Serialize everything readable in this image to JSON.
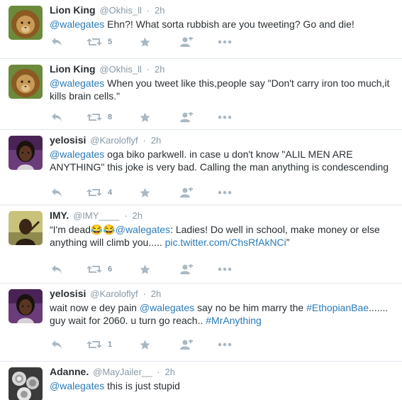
{
  "tweets": [
    {
      "fullname": "Lion King",
      "username": "@Okhis_ll",
      "time": "2h",
      "avatar_icon": "lion-avatar",
      "text": [
        {
          "type": "mention",
          "value": "@walegates"
        },
        {
          "type": "text",
          "value": " Ehn?! What sorta rubbish are you tweeting? Go and die!"
        }
      ],
      "retweets": "5"
    },
    {
      "fullname": "Lion King",
      "username": "@Okhis_ll",
      "time": "2h",
      "avatar_icon": "lion-avatar",
      "text": [
        {
          "type": "mention",
          "value": "@walegates"
        },
        {
          "type": "text",
          "value": " When you tweet like this,people say \"Don't carry iron too much,it kills brain cells.\""
        }
      ],
      "retweets": "8"
    },
    {
      "fullname": "yelosisi",
      "username": "@Karoloflyf",
      "time": "2h",
      "avatar_icon": "woman-avatar",
      "text": [
        {
          "type": "mention",
          "value": "@walegates"
        },
        {
          "type": "text",
          "value": " oga biko parkwell. in case u don't know \"ALIL MEN ARE ANYTHING\" this joke is very bad. Calling the man anything is condescending"
        }
      ],
      "retweets": "4"
    },
    {
      "fullname": "IMY.",
      "username": "@IMY____",
      "time": "2h",
      "avatar_icon": "man-avatar",
      "text": [
        {
          "type": "text",
          "value": "“I'm dead😂😂"
        },
        {
          "type": "mention",
          "value": "@walegates"
        },
        {
          "type": "text",
          "value": ": Ladies! Do well in school, make money or else anything will climb you..... "
        },
        {
          "type": "link",
          "value": "pic.twitter.com/ChsRfAkNCi"
        },
        {
          "type": "text",
          "value": "”"
        }
      ],
      "retweets": "6"
    },
    {
      "fullname": "yelosisi",
      "username": "@Karoloflyf",
      "time": "2h",
      "avatar_icon": "woman-avatar",
      "text": [
        {
          "type": "text",
          "value": "wait now e dey pain "
        },
        {
          "type": "mention",
          "value": "@walegates"
        },
        {
          "type": "text",
          "value": " say no be him marry the "
        },
        {
          "type": "hashtag",
          "value": "#EthopianBae"
        },
        {
          "type": "text",
          "value": "....... guy wait for 2060. u turn go reach.. "
        },
        {
          "type": "hashtag",
          "value": "#MrAnything"
        }
      ],
      "retweets": "1"
    },
    {
      "fullname": "Adanne.",
      "username": "@MayJailer__",
      "time": "2h",
      "avatar_icon": "roses-avatar",
      "text": [
        {
          "type": "mention",
          "value": "@walegates"
        },
        {
          "type": "text",
          "value": " this is just stupid"
        }
      ],
      "retweets": ""
    }
  ],
  "separator": "·",
  "colors": {
    "link": "#2b7bb9",
    "meta": "#8899a6",
    "icon": "#aab8c2",
    "border": "#e1e8ed",
    "text": "#292f33"
  }
}
